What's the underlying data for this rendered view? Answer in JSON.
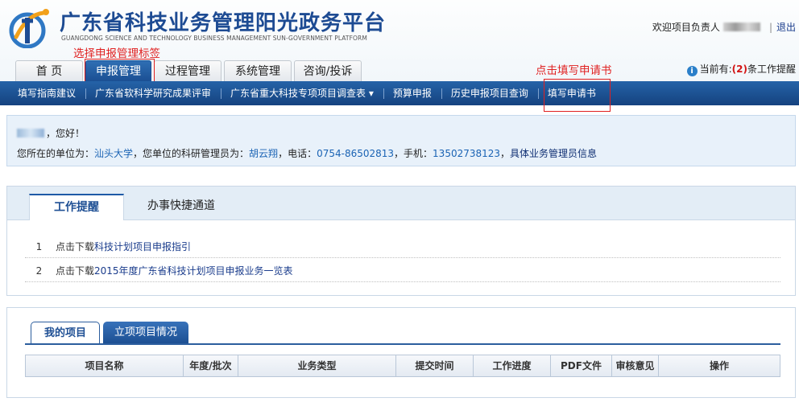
{
  "header": {
    "title": "广东省科技业务管理阳光政务平台",
    "subtitle": "GUANGDONG SCIENCE AND TECHNOLOGY BUSINESS MANAGEMENT SUN-GOVERNMENT PLATFORM",
    "welcome_prefix": "欢迎项目负责人",
    "logout": "退出"
  },
  "main_tabs": [
    {
      "label": "首 页"
    },
    {
      "label": "申报管理"
    },
    {
      "label": "过程管理"
    },
    {
      "label": "系统管理"
    },
    {
      "label": "咨询/投诉"
    }
  ],
  "annotations": {
    "select_tab": "选择申报管理标签",
    "fill_form": "点击填写申请书"
  },
  "alert": {
    "prefix": "当前有:",
    "count": "(2)",
    "suffix": "条工作提醒"
  },
  "subnav": [
    {
      "label": "填写指南建议"
    },
    {
      "label": "广东省软科学研究成果评审"
    },
    {
      "label": "广东省重大科技专项项目调查表 ▾"
    },
    {
      "label": "预算申报"
    },
    {
      "label": "历史申报项目查询"
    },
    {
      "label": "填写申请书"
    }
  ],
  "userinfo": {
    "greeting": "，您好！",
    "unit_label": "您所在的单位为：",
    "unit": "汕头大学",
    "admin_label": "，您单位的科研管理员为：",
    "admin": "胡云翔",
    "phone_label": "，电话：",
    "phone": "0754-86502813",
    "mobile_label": "，手机：",
    "mobile": "13502738123",
    "admin_info_link": "具体业务管理员信息"
  },
  "work_panel": {
    "tab_active": "工作提醒",
    "tab_other": "办事快捷通道",
    "items": [
      {
        "index": "1",
        "prefix": "点击下载",
        "link": "科技计划项目申报指引"
      },
      {
        "index": "2",
        "prefix": "点击下载",
        "link": "2015年度广东省科技计划项目申报业务一览表"
      }
    ]
  },
  "project_panel": {
    "tab_active": "我的项目",
    "tab_other": "立项项目情况",
    "columns": [
      "项目名称",
      "年度/批次",
      "业务类型",
      "提交时间",
      "工作进度",
      "PDF文件",
      "审核意见",
      "操作"
    ]
  },
  "colors": {
    "brand": "#1d4b93",
    "nav": "#1b4f93",
    "annotation": "#e02020"
  }
}
